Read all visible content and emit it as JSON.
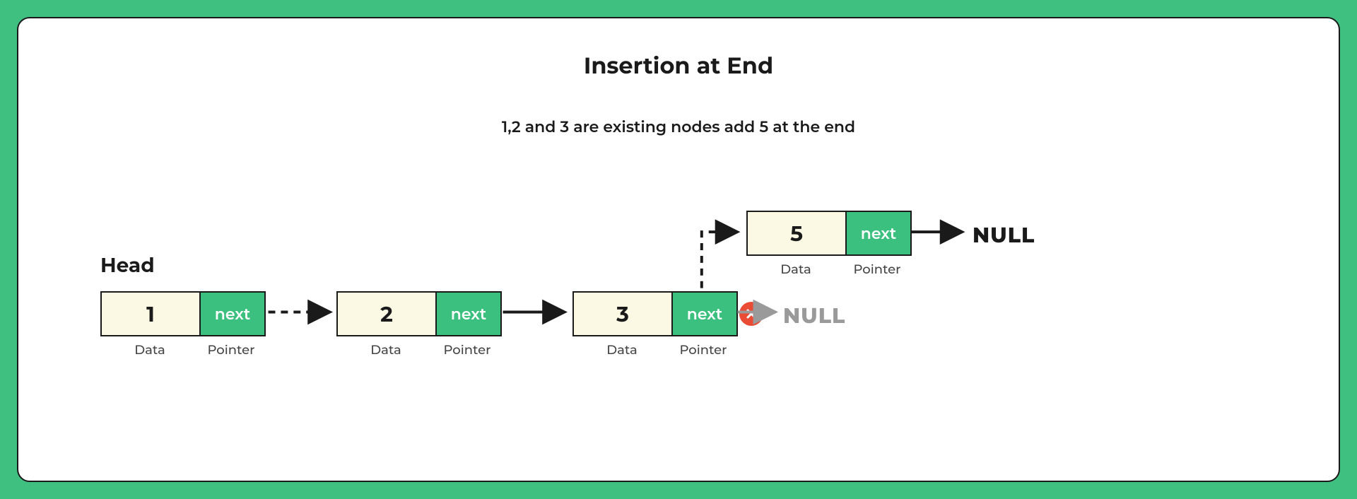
{
  "title": "Insertion at End",
  "subtitle": "1,2 and 3 are existing nodes add 5 at the end",
  "head_label": "Head",
  "labels": {
    "data": "Data",
    "pointer": "Pointer",
    "next": "next"
  },
  "null_label": "NULL",
  "nodes": [
    {
      "value": "1"
    },
    {
      "value": "2"
    },
    {
      "value": "3"
    },
    {
      "value": "5"
    }
  ],
  "colors": {
    "frame": "#40c080",
    "node_data_bg": "#fbf9e3",
    "node_ptr_bg": "#3cc07f",
    "removed": "#9a9a9a",
    "close_badge": "#e94b35"
  }
}
